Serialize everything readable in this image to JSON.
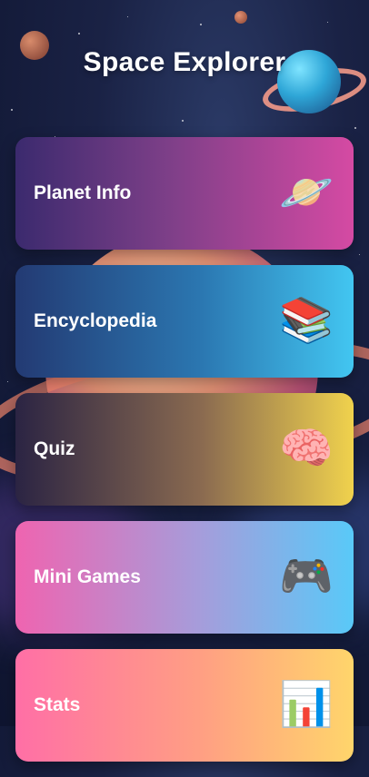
{
  "header": {
    "title": "Space Explorer"
  },
  "menu": [
    {
      "label": "Planet Info",
      "icon": "🪐",
      "icon_name": "planet-icon"
    },
    {
      "label": "Encyclopedia",
      "icon": "📚",
      "icon_name": "books-icon"
    },
    {
      "label": "Quiz",
      "icon": "🧠",
      "icon_name": "brain-icon"
    },
    {
      "label": "Mini Games",
      "icon": "🎮",
      "icon_name": "gamepad-icon"
    },
    {
      "label": "Stats",
      "icon": "📊",
      "icon_name": "chart-icon"
    }
  ]
}
